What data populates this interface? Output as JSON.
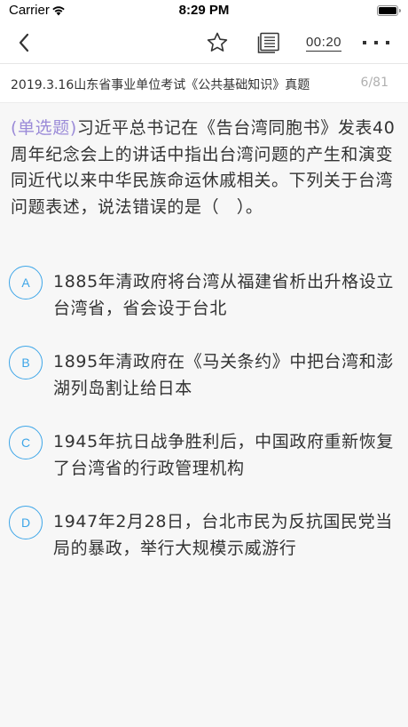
{
  "status_bar": {
    "carrier": "Carrier",
    "time": "8:29 PM"
  },
  "nav": {
    "back_icon": "chevron-left-icon",
    "favorite_icon": "star-outline-icon",
    "answer_card_icon": "answer-card-icon",
    "timer": "00:20",
    "more_icon": "more-dots-icon"
  },
  "exam": {
    "title": "2019.3.16山东省事业单位考试《公共基础知识》真题",
    "progress": "6/81"
  },
  "question": {
    "type_label": "(单选题)",
    "stem": "习近平总书记在《告台湾同胞书》发表40周年纪念会上的讲话中指出台湾问题的产生和演变同近代以来中华民族命运休戚相关。下列关于台湾问题表述，说法错误的是（　）。",
    "options": [
      {
        "letter": "A",
        "text": "1885年清政府将台湾从福建省析出升格设立台湾省，省会设于台北"
      },
      {
        "letter": "B",
        "text": "1895年清政府在《马关条约》中把台湾和澎湖列岛割让给日本"
      },
      {
        "letter": "C",
        "text": "1945年抗日战争胜利后，中国政府重新恢复了台湾省的行政管理机构"
      },
      {
        "letter": "D",
        "text": "1947年2月28日，台北市民为反抗国民党当局的暴政，举行大规模示威游行"
      }
    ]
  },
  "colors": {
    "accent": "#3ea6e8",
    "question_type": "#9b8bd8",
    "text": "#333333",
    "muted": "#b0b0b0",
    "background": "#f7f7f7"
  }
}
